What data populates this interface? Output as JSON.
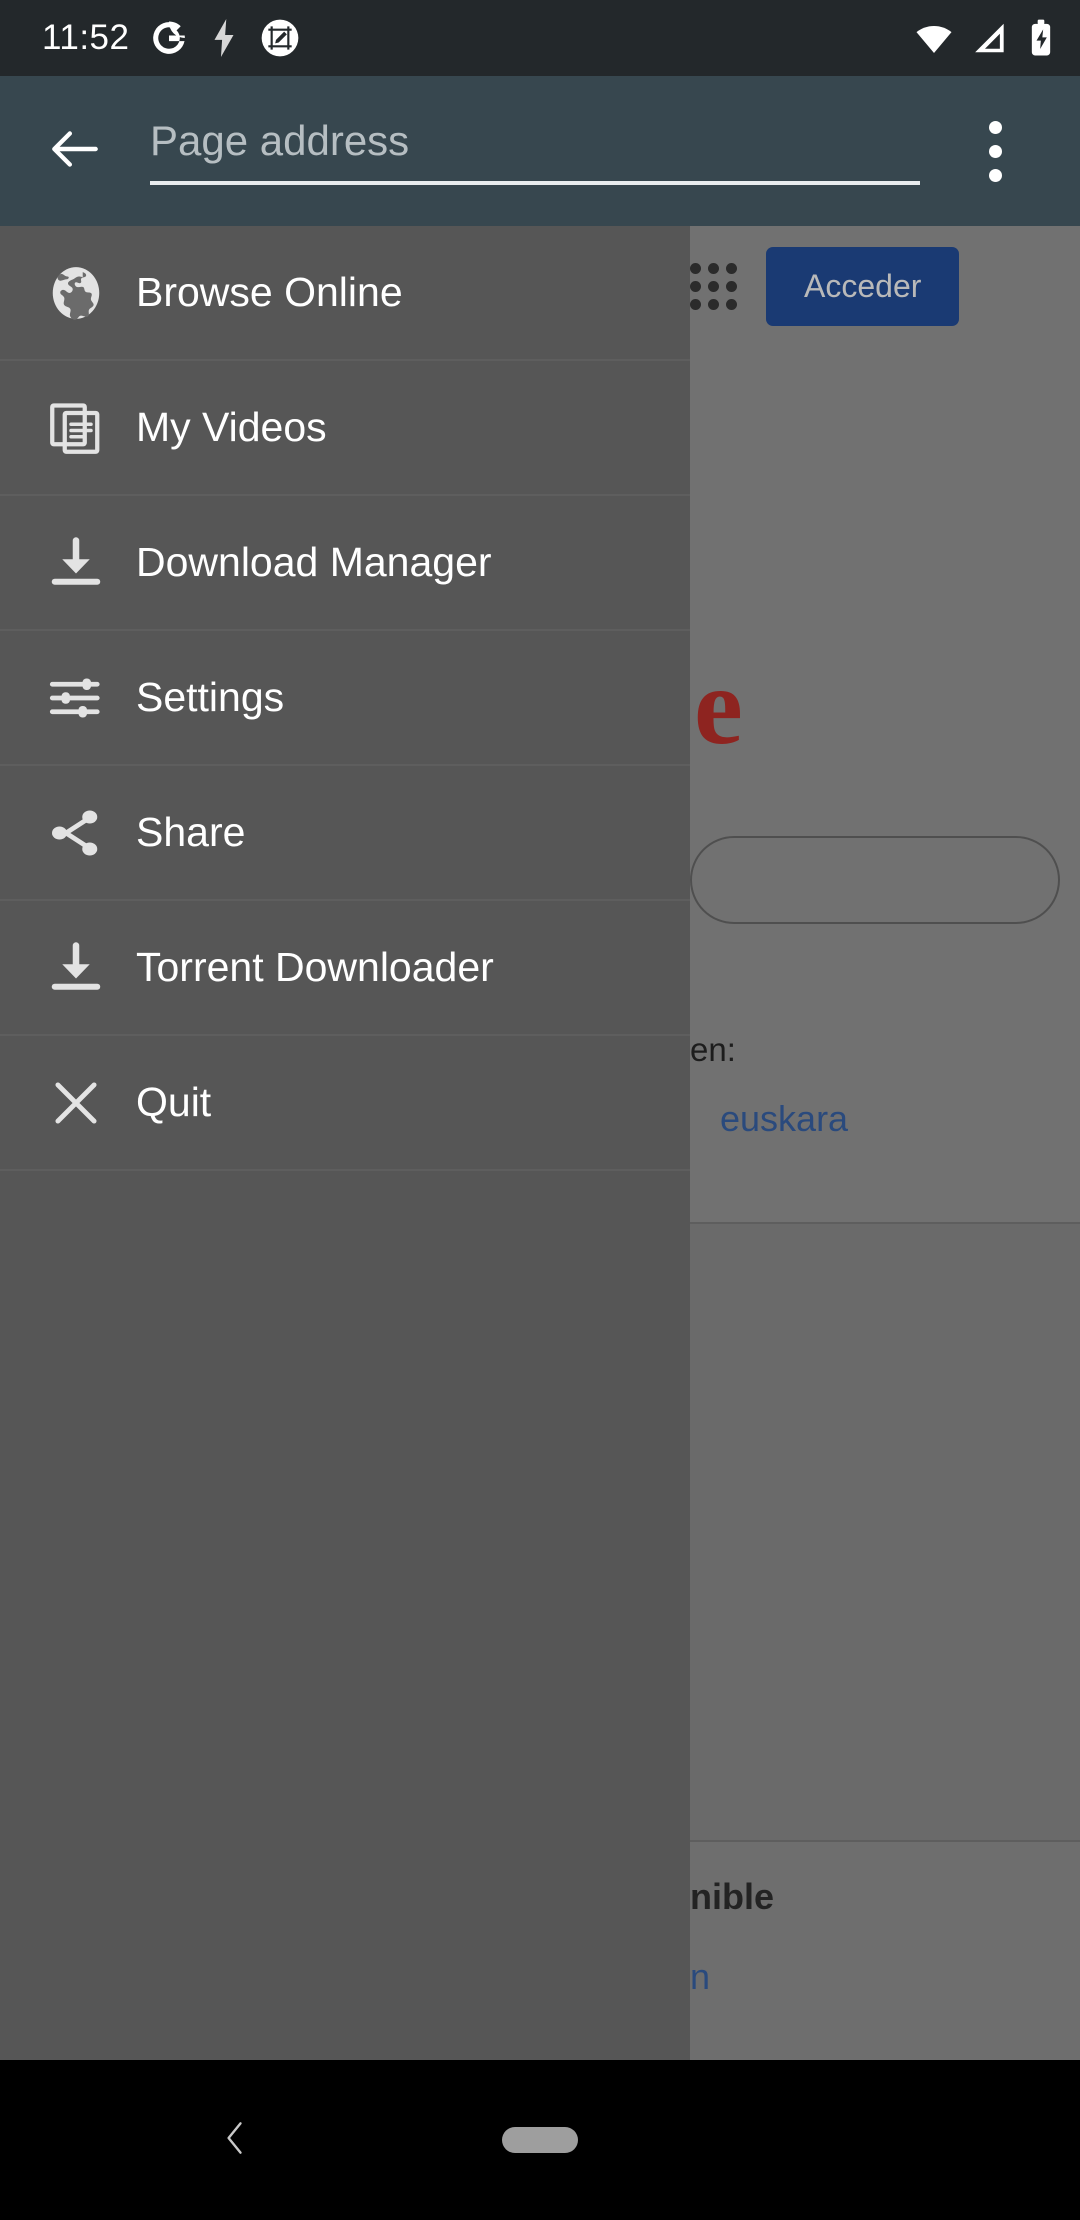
{
  "status_bar": {
    "time": "11:52",
    "left_icons": [
      "google-g-icon",
      "lightning-bolt-icon",
      "screenshot-edit-icon"
    ],
    "right_icons": [
      "wifi-icon",
      "cellular-signal-icon",
      "battery-charging-icon"
    ],
    "background_color": "#23282b"
  },
  "toolbar": {
    "background_color": "#37474f",
    "back_icon": "back-arrow-icon",
    "address": {
      "value": "",
      "placeholder": "Page address"
    },
    "overflow_icon": "more-vert-icon"
  },
  "drawer": {
    "background_color": "#565656",
    "items": [
      {
        "label": "Browse Online",
        "icon": "globe-icon"
      },
      {
        "label": "My Videos",
        "icon": "documents-copy-icon"
      },
      {
        "label": "Download Manager",
        "icon": "download-icon"
      },
      {
        "label": "Settings",
        "icon": "tune-sliders-icon"
      },
      {
        "label": "Share",
        "icon": "share-nodes-icon"
      },
      {
        "label": "Torrent Downloader",
        "icon": "download-icon"
      },
      {
        "label": "Quit",
        "icon": "close-x-icon"
      }
    ]
  },
  "page": {
    "login_button": "Acceder",
    "apps_grid_icon": "apps-grid-icon",
    "logo_letter": "e",
    "logo_color": "#8e2420",
    "search_placeholder": "",
    "lang_intro": "en:",
    "lang_link": "euskara",
    "footer_bold": "nible",
    "footer_link": "n",
    "link_color": "#2a4a7d",
    "button_color": "#1a3a73"
  },
  "nav_bar": {
    "back_icon": "chevron-left-icon",
    "home_handle": "home-pill-handle"
  }
}
